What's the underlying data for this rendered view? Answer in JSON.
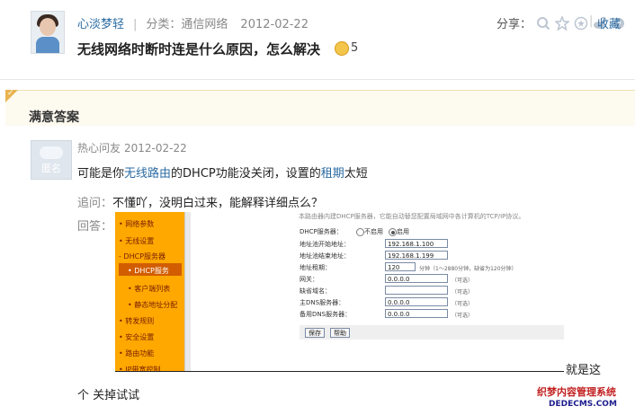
{
  "question": {
    "user": "心淡梦轻",
    "category_label": "分类：通信网络",
    "date": "2012-02-22",
    "title": "无线网络时断时连是什么原因，怎么解决",
    "reward": "5",
    "share_label": "分享：",
    "favorite_label": "收藏"
  },
  "best_answer": {
    "heading": "满意答案",
    "avatar_label": "匿名",
    "author": "热心问友",
    "date": "2012-02-22",
    "text_pre": "可能是你",
    "link1": "无线路由",
    "text_mid": "的DHCP功能没关闭，设置的",
    "link2": "租期",
    "text_post": "太短",
    "followup_q_label": "追问：",
    "followup_q": "不懂吖，没明白过来，能解释详细点么？",
    "followup_a_label": "回答：",
    "caption": "就是这",
    "last_line": "个  关掉试试"
  },
  "screenshot": {
    "top_text": "本路由器内建DHCP服务器，它能自动替您配置局域网中各计算机的TCP/IP协议。",
    "nav": [
      "• 网络参数",
      "• 无线设置",
      "- DHCP服务器",
      "• DHCP服务",
      "• 客户端列表",
      "• 静态地址分配",
      "• 转发规则",
      "• 安全设置",
      "• 路由功能",
      "• IP带宽控制"
    ],
    "fields": {
      "dhcp_server": "DHCP服务器：",
      "disable": "不启用",
      "enable": "启用",
      "pool_start_label": "地址池开始地址：",
      "pool_start": "192.168.1.100",
      "pool_end_label": "地址池结束地址：",
      "pool_end": "192.168.1.199",
      "lease_label": "地址租期：",
      "lease": "120",
      "lease_hint": "分钟（1～2880分钟，缺省为120分钟）",
      "gateway_label": "网关：",
      "gateway": "0.0.0.0",
      "domain_label": "缺省域名：",
      "dns1_label": "主DNS服务器：",
      "dns1": "0.0.0.0",
      "dns2_label": "备用DNS服务器：",
      "dns2": "0.0.0.0",
      "optional": "（可选）",
      "save": "保存",
      "help": "帮助"
    }
  },
  "watermark": {
    "line1": "织梦内容管理系统",
    "line2": "DEDECMS.COM"
  },
  "colors": {
    "link": "#2b6ba3",
    "nav_orange": "#ffa800",
    "reward_coin": "#f3c64b"
  }
}
